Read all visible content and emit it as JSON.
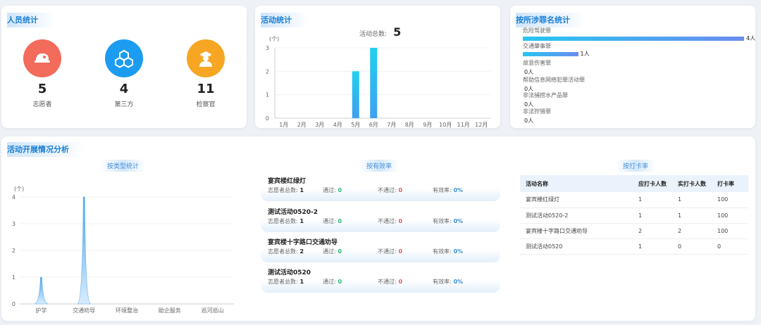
{
  "personnel": {
    "title": "人员统计",
    "items": [
      {
        "value": "5",
        "label": "志愿者",
        "color": "#f26b5b",
        "icon": "cap-icon"
      },
      {
        "value": "4",
        "label": "第三方",
        "color": "#1c9cf0",
        "icon": "cubes-icon"
      },
      {
        "value": "11",
        "label": "检察官",
        "color": "#f6a623",
        "icon": "officer-icon"
      }
    ]
  },
  "activity": {
    "title": "活动统计",
    "total_label": "活动总数:",
    "total_value": "5",
    "y_unit": "(个)",
    "chart_data": {
      "type": "bar",
      "categories": [
        "1月",
        "2月",
        "3月",
        "4月",
        "5月",
        "6月",
        "7月",
        "8月",
        "9月",
        "10月",
        "11月",
        "12月"
      ],
      "values": [
        0,
        0,
        0,
        0,
        2,
        3,
        0,
        0,
        0,
        0,
        0,
        0
      ],
      "ylim": [
        0,
        3
      ],
      "yticks": [
        "0",
        "1",
        "2",
        "3"
      ]
    }
  },
  "crime": {
    "title": "按所涉罪名统计",
    "chart_data": {
      "type": "bar",
      "orientation": "horizontal",
      "categories": [
        "危险驾驶罪",
        "交通肇事罪",
        "故意伤害罪",
        "帮助信息网络犯罪活动罪",
        "非法捕捞水产品罪",
        "非法狩猎罪"
      ],
      "values": [
        4,
        1,
        0,
        0,
        0,
        0
      ],
      "value_labels": [
        "4人",
        "1人",
        "0人",
        "0人",
        "0人",
        "0人"
      ],
      "max": 4
    }
  },
  "analysis": {
    "title": "活动开展情况分析",
    "by_type": {
      "title": "按类型统计",
      "y_unit": "(个)",
      "chart_data": {
        "type": "area",
        "categories": [
          "护学",
          "交通劝导",
          "环境整治",
          "助企服务",
          "巡河巡山"
        ],
        "values": [
          1,
          4,
          0,
          0,
          0
        ],
        "ylim": [
          0,
          4
        ],
        "yticks": [
          "0",
          "1",
          "2",
          "3",
          "4"
        ]
      }
    },
    "by_effect": {
      "title": "按有效率",
      "labels": {
        "volunteers": "志愿者总数:",
        "pass": "通过:",
        "fail": "不通过:",
        "rate": "有效率:"
      },
      "items": [
        {
          "name": "宴宾楼红绿灯",
          "volunteers": "1",
          "pass": "0",
          "fail": "0",
          "rate": "0%"
        },
        {
          "name": "测试活动0520-2",
          "volunteers": "1",
          "pass": "0",
          "fail": "0",
          "rate": "0%"
        },
        {
          "name": "宴宾楼十字路口交通劝导",
          "volunteers": "2",
          "pass": "0",
          "fail": "0",
          "rate": "0%"
        },
        {
          "name": "测试活动0520",
          "volunteers": "1",
          "pass": "0",
          "fail": "0",
          "rate": "0%"
        }
      ]
    },
    "by_checkin": {
      "title": "按打卡率",
      "headers": [
        "活动名称",
        "应打卡人数",
        "实打卡人数",
        "打卡率"
      ],
      "rows": [
        [
          "宴宾楼红绿灯",
          "1",
          "1",
          "100"
        ],
        [
          "测试活动0520-2",
          "1",
          "1",
          "100"
        ],
        [
          "宴宾楼十字路口交通劝导",
          "2",
          "2",
          "100"
        ],
        [
          "测试活动0520",
          "1",
          "0",
          "0"
        ]
      ]
    }
  }
}
